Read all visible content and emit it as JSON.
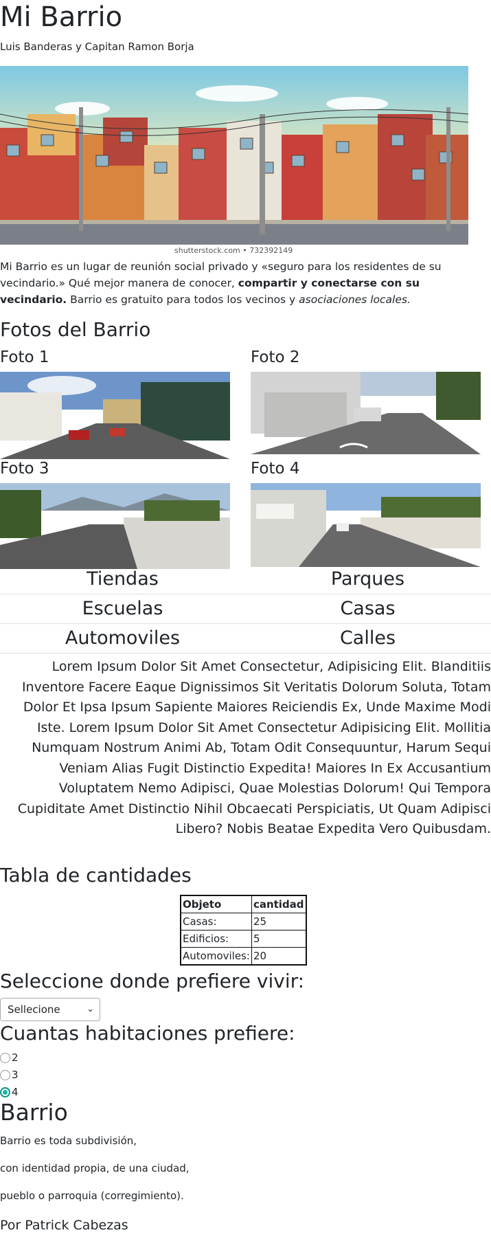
{
  "header": {
    "title": "Mi Barrio",
    "subtitle": "Luis Banderas y Capitan Ramon Borja"
  },
  "hero": {
    "credit": "shutterstock.com • 732392149"
  },
  "intro": {
    "text_1": "Mi Barrio es un lugar de reunión social privado y «seguro para los residentes de su vecindario.» Qué mejor manera de conocer, ",
    "bold": "compartir y conectarse con su vecindario.",
    "text_2": " Barrio es gratuito para todos los vecinos y ",
    "italic": "asociaciones locales."
  },
  "photos": {
    "title": "Fotos del Barrio",
    "items": [
      {
        "label": "Foto 1"
      },
      {
        "label": "Foto 2"
      },
      {
        "label": "Foto 3"
      },
      {
        "label": "Foto 4"
      }
    ]
  },
  "categories": [
    [
      "Tiendas",
      "Parques"
    ],
    [
      "Escuelas",
      "Casas"
    ],
    [
      "Automoviles",
      "Calles"
    ]
  ],
  "lorem": "Lorem Ipsum Dolor Sit Amet Consectetur, Adipisicing Elit. Blanditiis Inventore Facere Eaque Dignissimos Sit Veritatis Dolorum Soluta, Totam Dolor Et Ipsa Ipsum Sapiente Maiores Reiciendis Ex, Unde Maxime Modi Iste. Lorem Ipsum Dolor Sit Amet Consectetur Adipisicing Elit. Mollitia Numquam Nostrum Animi Ab, Totam Odit Consequuntur, Harum Sequi Veniam Alias Fugit Distinctio Expedita! Maiores In Ex Accusantium Voluptatem Nemo Adipisci, Quae Molestias Dolorum! Qui Tempora Cupiditate Amet Distinctio Nihil Obcaecati Perspiciatis, Ut Quam Adipisci Libero? Nobis Beatae Expedita Vero Quibusdam.",
  "table": {
    "title": "Tabla de cantidades",
    "headers": [
      "Objeto",
      "cantidad"
    ],
    "rows": [
      [
        "Casas:",
        "25"
      ],
      [
        "Edificios:",
        "5"
      ],
      [
        "Automoviles:",
        "20"
      ]
    ]
  },
  "preference": {
    "title": "Seleccione donde prefiere vivir:",
    "select_value": "Sellecione"
  },
  "rooms": {
    "title": "Cuantas habitaciones prefiere:",
    "options": [
      "2",
      "3",
      "4"
    ],
    "selected": "4"
  },
  "barrio": {
    "title": "Barrio",
    "lines": [
      "Barrio es toda subdivisión,",
      "con identidad propia, de una ciudad,",
      "pueblo o parroquia (corregimiento)."
    ],
    "author": "Por Patrick Cabezas"
  }
}
